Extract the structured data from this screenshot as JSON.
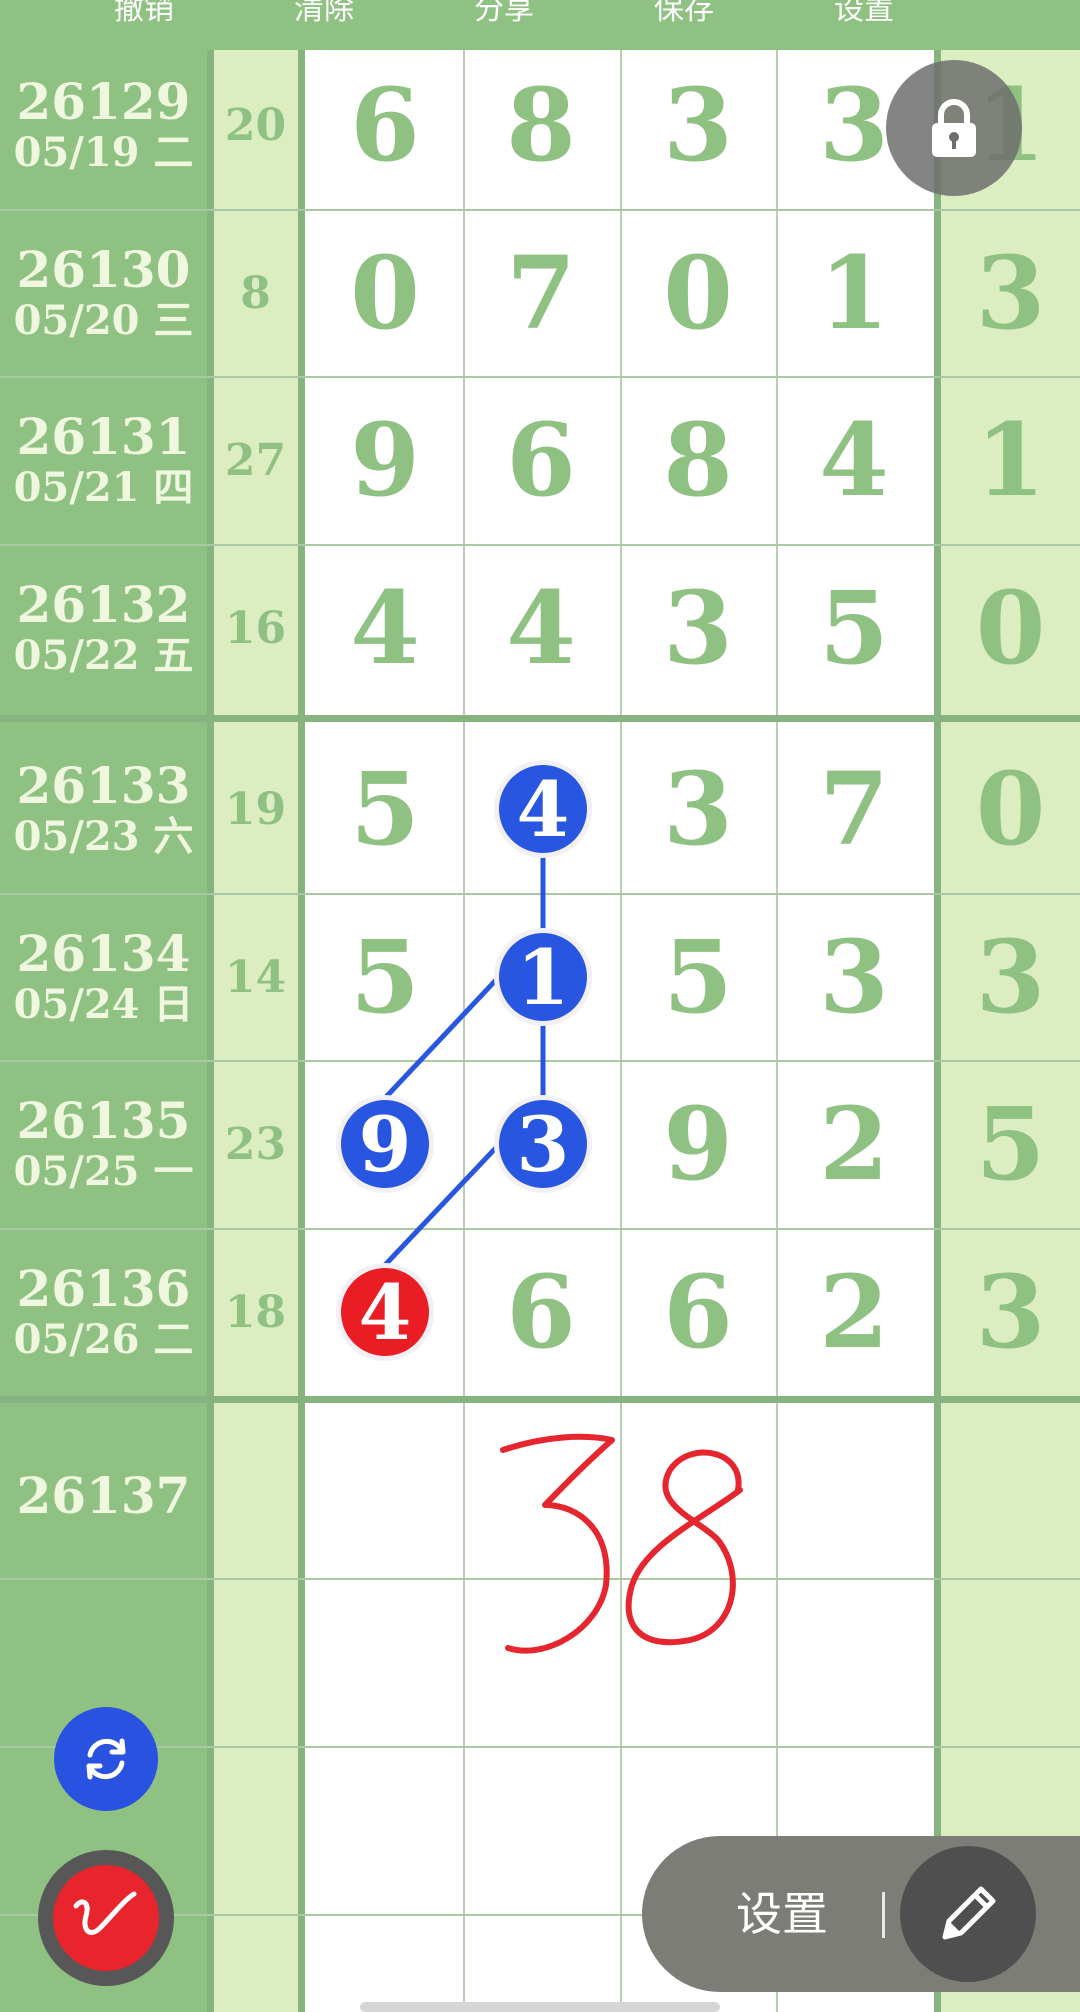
{
  "toolbar": {
    "items": [
      "撤销",
      "清除",
      "分享",
      "保存",
      "设置"
    ]
  },
  "rows": [
    {
      "issue": "26129",
      "date": "05/19 二",
      "sum": "20",
      "digits": [
        "6",
        "8",
        "3",
        "3",
        "1"
      ]
    },
    {
      "issue": "26130",
      "date": "05/20 三",
      "sum": "8",
      "digits": [
        "0",
        "7",
        "0",
        "1",
        "3"
      ]
    },
    {
      "issue": "26131",
      "date": "05/21 四",
      "sum": "27",
      "digits": [
        "9",
        "6",
        "8",
        "4",
        "1"
      ]
    },
    {
      "issue": "26132",
      "date": "05/22 五",
      "sum": "16",
      "digits": [
        "4",
        "4",
        "3",
        "5",
        "0"
      ]
    },
    {
      "issue": "26133",
      "date": "05/23 六",
      "sum": "19",
      "digits": [
        "5",
        "4",
        "3",
        "7",
        "0"
      ]
    },
    {
      "issue": "26134",
      "date": "05/24 日",
      "sum": "14",
      "digits": [
        "5",
        "1",
        "5",
        "3",
        "3"
      ]
    },
    {
      "issue": "26135",
      "date": "05/25 一",
      "sum": "23",
      "digits": [
        "9",
        "3",
        "9",
        "2",
        "5"
      ]
    },
    {
      "issue": "26136",
      "date": "05/26 二",
      "sum": "18",
      "digits": [
        "4",
        "6",
        "6",
        "2",
        "3"
      ]
    },
    {
      "issue": "26137",
      "date": "",
      "sum": "",
      "digits": [
        "",
        "",
        "",
        "",
        ""
      ]
    }
  ],
  "marked_balls": [
    {
      "row": 4,
      "col": 1,
      "value": "4",
      "color": "#2856e0"
    },
    {
      "row": 5,
      "col": 1,
      "value": "1",
      "color": "#2856e0"
    },
    {
      "row": 6,
      "col": 0,
      "value": "9",
      "color": "#2856e0"
    },
    {
      "row": 6,
      "col": 1,
      "value": "3",
      "color": "#2856e0"
    },
    {
      "row": 7,
      "col": 0,
      "value": "4",
      "color": "#ea1c24"
    }
  ],
  "handwritten_note": "38",
  "controls": {
    "settings_label": "设置",
    "lock_icon": "lock-icon",
    "refresh_icon": "refresh-icon",
    "pen_icon": "pen-icon",
    "edit_icon": "pencil-icon"
  },
  "colors": {
    "green_header": "#8fc183",
    "light_green": "#dcedc2",
    "digit_green": "#8fc183",
    "ball_blue": "#2856e0",
    "ball_red": "#ea1c24"
  }
}
